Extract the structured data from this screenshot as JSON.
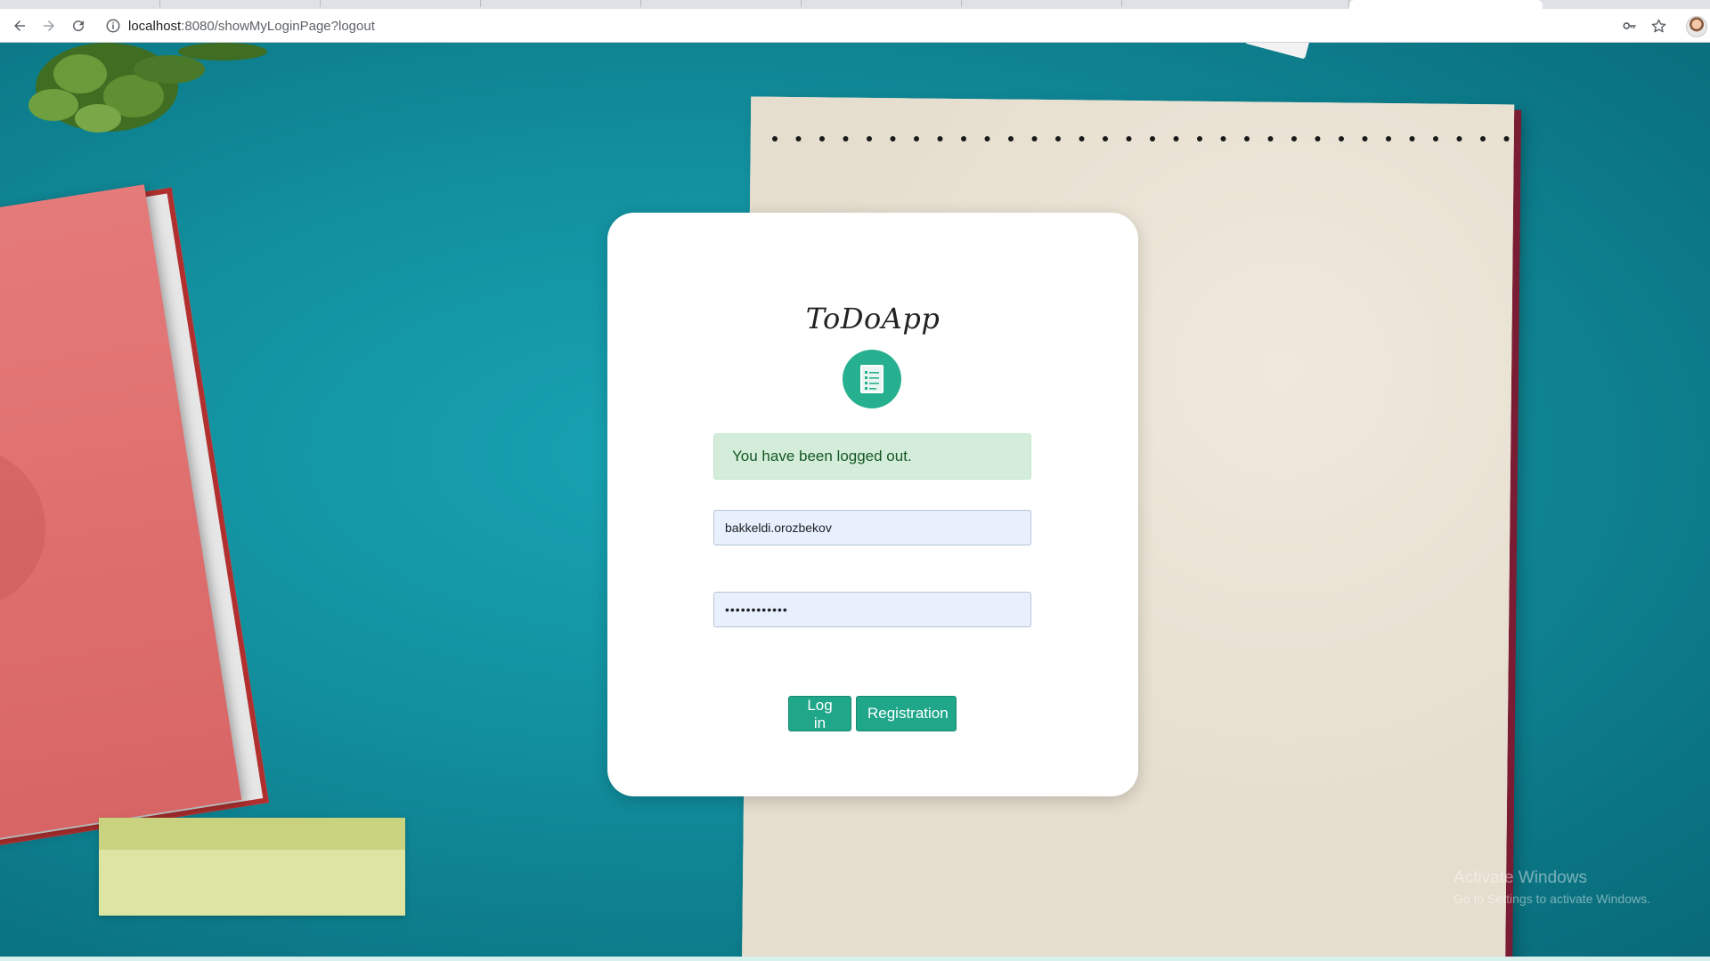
{
  "browser": {
    "url_host": "localhost",
    "url_path": ":8080/showMyLoginPage?logout",
    "icons": [
      "back-arrow-icon",
      "forward-arrow-icon",
      "reload-icon",
      "info-icon",
      "key-icon",
      "star-icon",
      "profile-avatar"
    ]
  },
  "login": {
    "app_title": "ToDoApp",
    "logo_icon": "checklist-document-icon",
    "alert_message": "You have been logged out.",
    "username_value": "bakkeldi.orozbekov",
    "password_value": "••••••••••••",
    "login_button": "Log in",
    "registration_button": "Registration"
  },
  "watermark": {
    "title": "Activate Windows",
    "subtitle": "Go to Settings to activate Windows."
  },
  "colors": {
    "accent": "#20a689",
    "alert_bg": "#d4edda",
    "alert_text": "#155724",
    "desk": "#12909f"
  }
}
